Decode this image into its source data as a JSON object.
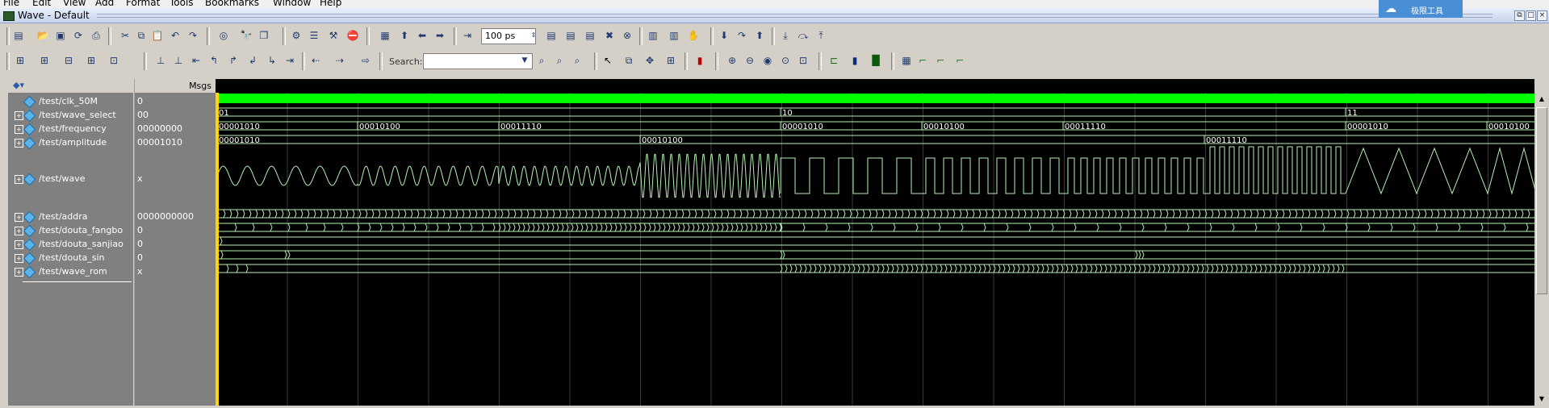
{
  "menu": [
    "File",
    "Edit",
    "View",
    "Add",
    "Format",
    "Tools",
    "Bookmarks",
    "Window",
    "Help"
  ],
  "window": {
    "title": "Wave - Default"
  },
  "cloud_badge": {
    "text": "极限工具"
  },
  "toolbar": {
    "time_value": "100 ps",
    "search_label": "Search:",
    "search_value": ""
  },
  "header": {
    "msgs": "Msgs"
  },
  "signals": [
    {
      "name": "/test/clk_50M",
      "value": "0",
      "expandable": false
    },
    {
      "name": "/test/wave_select",
      "value": "00",
      "expandable": true
    },
    {
      "name": "/test/frequency",
      "value": "00000000",
      "expandable": true
    },
    {
      "name": "/test/amplitude",
      "value": "00001010",
      "expandable": true
    },
    {
      "name": "/test/wave",
      "value": "x",
      "expandable": true
    },
    {
      "name": "/test/addra",
      "value": "0000000000",
      "expandable": true
    },
    {
      "name": "/test/douta_fangbo",
      "value": "0",
      "expandable": true
    },
    {
      "name": "/test/douta_sanjiao",
      "value": "0",
      "expandable": true
    },
    {
      "name": "/test/douta_sin",
      "value": "0",
      "expandable": true
    },
    {
      "name": "/test/wave_rom",
      "value": "x",
      "expandable": true
    }
  ],
  "bus_labels": {
    "wave_select": [
      "01",
      "10",
      "11"
    ],
    "frequency": [
      "00001010",
      "00010100",
      "00011110",
      "00001010",
      "00010100",
      "00011110",
      "00001010",
      "00010100"
    ],
    "amplitude": [
      "00001010",
      "00010100",
      "00011110"
    ]
  },
  "colors": {
    "wave": "#b6f0b6",
    "clk": "#00ff00",
    "cursor": "#ffd700",
    "grid": "#3a3a3a"
  }
}
